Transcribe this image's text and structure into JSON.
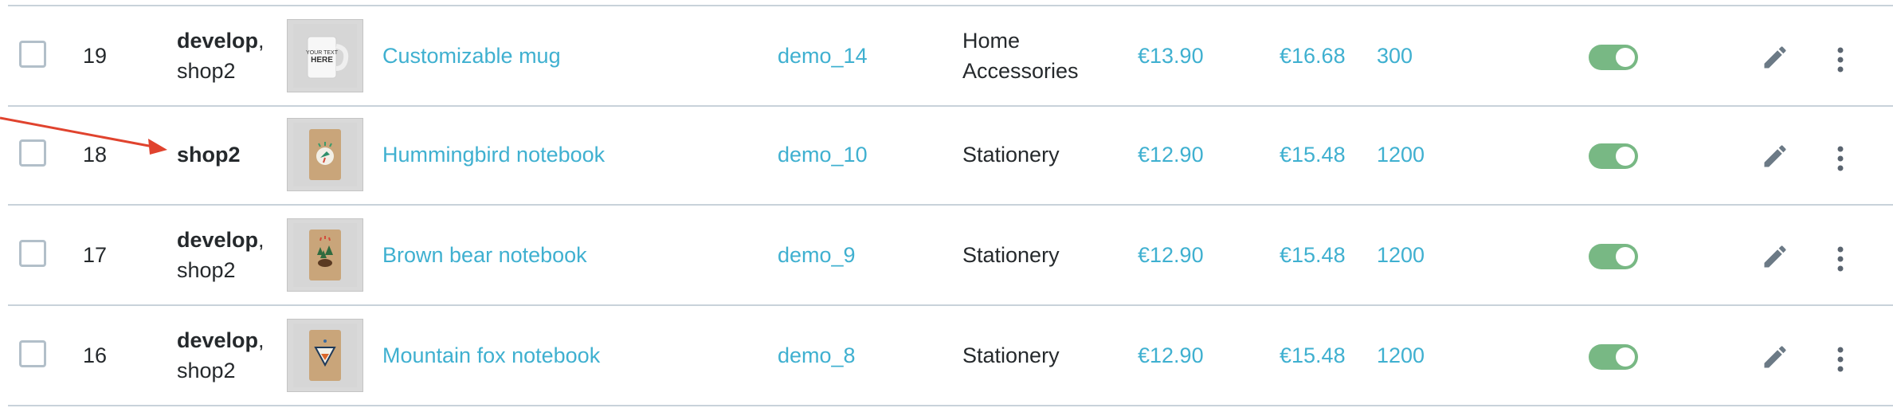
{
  "rows": [
    {
      "id": "19",
      "shop_bold": "develop",
      "shop_sep": ",",
      "shop_rest": "shop2",
      "image_icon": "mug-image",
      "name": "Customizable mug",
      "reference": "demo_14",
      "category_line1": "Home",
      "category_line2": "Accessories",
      "price": "€13.90",
      "price_tax": "€16.68",
      "quantity": "300",
      "status": "enabled"
    },
    {
      "id": "18",
      "shop_bold": "shop2",
      "shop_sep": "",
      "shop_rest": "",
      "image_icon": "hummingbird-notebook-image",
      "name": "Hummingbird notebook",
      "reference": "demo_10",
      "category_line1": "Stationery",
      "category_line2": "",
      "price": "€12.90",
      "price_tax": "€15.48",
      "quantity": "1200",
      "status": "enabled"
    },
    {
      "id": "17",
      "shop_bold": "develop",
      "shop_sep": ",",
      "shop_rest": "shop2",
      "image_icon": "brown-bear-notebook-image",
      "name": "Brown bear notebook",
      "reference": "demo_9",
      "category_line1": "Stationery",
      "category_line2": "",
      "price": "€12.90",
      "price_tax": "€15.48",
      "quantity": "1200",
      "status": "enabled"
    },
    {
      "id": "16",
      "shop_bold": "develop",
      "shop_sep": ",",
      "shop_rest": "shop2",
      "image_icon": "mountain-fox-notebook-image",
      "name": "Mountain fox notebook",
      "reference": "demo_8",
      "category_line1": "Stationery",
      "category_line2": "",
      "price": "€12.90",
      "price_tax": "€15.48",
      "quantity": "1200",
      "status": "enabled"
    }
  ],
  "mug_print": [
    "YOUR TEXT",
    "HERE"
  ],
  "colors": {
    "link": "#3fb0d0",
    "toggle_on": "#78b884",
    "divider": "#c8d2da",
    "annotation_arrow": "#e0432e"
  },
  "icons": {
    "edit": "pencil-icon",
    "more": "kebab-menu-icon",
    "annotation": "red-arrow-annotation"
  }
}
